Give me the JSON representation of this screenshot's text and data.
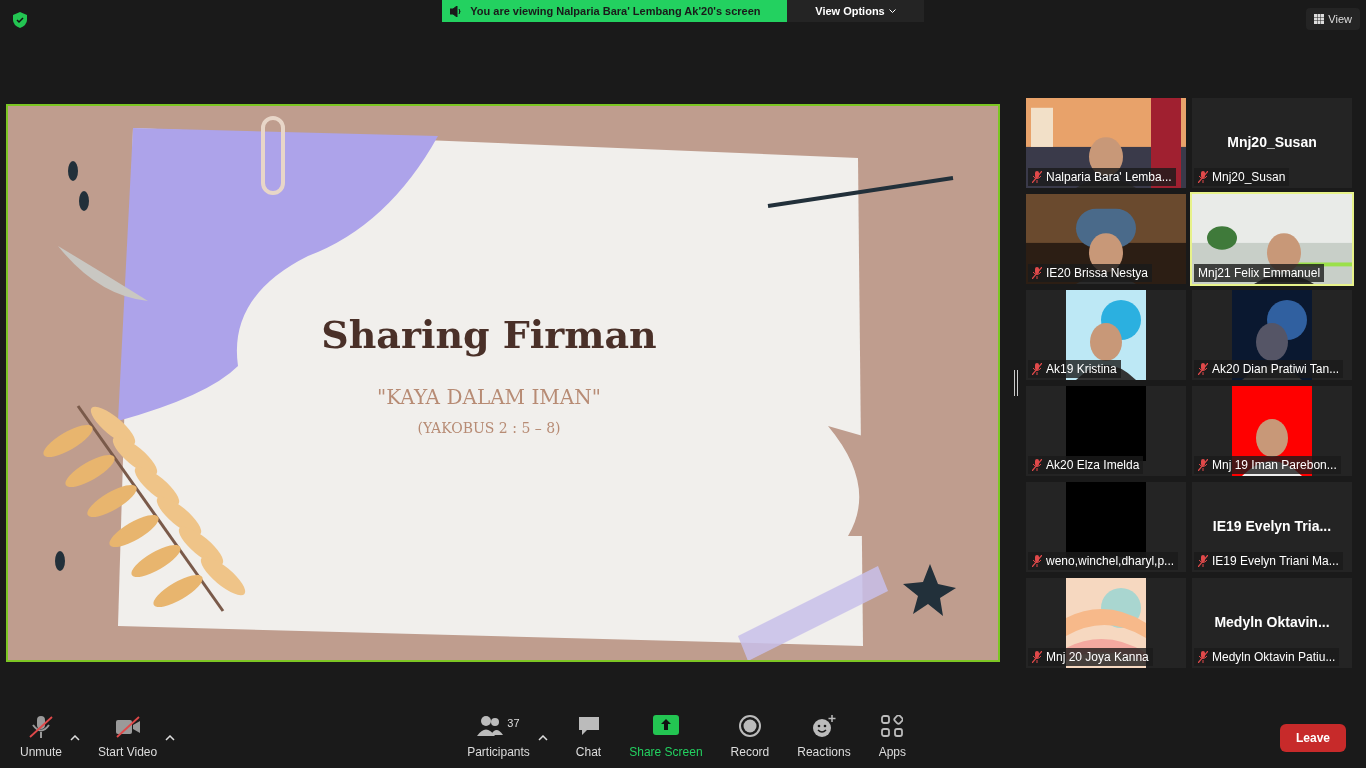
{
  "top_bar": {
    "banner": "You are viewing Nalparia Bara' Lembang Ak'20's screen",
    "view_options": "View Options",
    "view": "View"
  },
  "slide": {
    "title": "Sharing Firman",
    "subtitle": "\"KAYA DALAM IMAN\"",
    "reference": "(YAKOBUS 2 : 5 – 8)"
  },
  "participants": [
    {
      "name": "Nalparia Bara' Lemba...",
      "kind": "video",
      "muted": true,
      "speaking": false
    },
    {
      "name": "Mnj20_Susan",
      "kind": "name",
      "display": "Mnj20_Susan",
      "muted": true,
      "speaking": false
    },
    {
      "name": "IE20 Brissa Nestya",
      "kind": "video",
      "muted": true,
      "speaking": false
    },
    {
      "name": "Mnj21 Felix Emmanuel",
      "kind": "video",
      "muted": false,
      "speaking": true
    },
    {
      "name": "Ak19 Kristina",
      "muted": true,
      "speaking": false
    },
    {
      "name": "Ak20 Dian Pratiwi Tan...",
      "muted": true,
      "speaking": false
    },
    {
      "name": "Ak20 Elza Imelda",
      "kind": "blank",
      "muted": true,
      "speaking": false
    },
    {
      "name": "Mnj 19 Iman Parebon...",
      "muted": true,
      "speaking": false
    },
    {
      "name": "weno,winchel,dharyl,p...",
      "kind": "blank",
      "muted": true,
      "speaking": false
    },
    {
      "name": "IE19 Evelyn Triani Ma...",
      "kind": "name",
      "display": "IE19  Evelyn  Tria...",
      "muted": true,
      "speaking": false
    },
    {
      "name": "Mnj 20 Joya Kanna",
      "muted": true,
      "speaking": false
    },
    {
      "name": "Medyln Oktavin Patiu...",
      "kind": "name",
      "display": "Medyln  Oktavin...",
      "muted": true,
      "speaking": false
    }
  ],
  "toolbar": {
    "left": [
      {
        "label": "Unmute",
        "kind": "mic",
        "off": true
      },
      {
        "label": "Start Video",
        "kind": "video",
        "off": true
      }
    ],
    "center": [
      {
        "label": "Participants",
        "kind": "participants",
        "count": "37"
      },
      {
        "label": "Chat",
        "kind": "chat"
      },
      {
        "label": "Share Screen",
        "kind": "share"
      },
      {
        "label": "Record",
        "kind": "record"
      },
      {
        "label": "Reactions",
        "kind": "reactions"
      },
      {
        "label": "Apps",
        "kind": "apps"
      }
    ],
    "leave": "Leave"
  }
}
